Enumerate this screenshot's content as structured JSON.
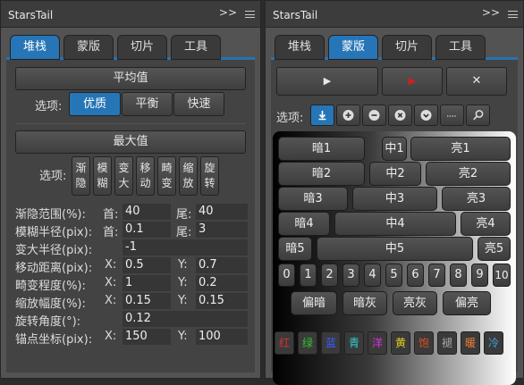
{
  "left": {
    "title": "StarsTail",
    "chevron": ">>",
    "tabs": [
      "堆栈",
      "蒙版",
      "切片",
      "工具"
    ],
    "avg_button": "平均值",
    "options_label": "选项:",
    "opt_buttons": [
      "优质",
      "平衡",
      "快速"
    ],
    "max_button": "最大值",
    "options2_label": "选项:",
    "effects": [
      [
        "渐",
        "隐"
      ],
      [
        "模",
        "糊"
      ],
      [
        "变",
        "大"
      ],
      [
        "移",
        "动"
      ],
      [
        "畸",
        "变"
      ],
      [
        "缩",
        "放"
      ],
      [
        "旋",
        "转"
      ]
    ],
    "rows": [
      {
        "label": "渐隐范围(%):",
        "k1": "首:",
        "v1": "40",
        "k2": "尾:",
        "v2": "40"
      },
      {
        "label": "模糊半径(pix):",
        "k1": "首:",
        "v1": "0.1",
        "k2": "尾:",
        "v2": "3"
      },
      {
        "label": "变大半径(pix):",
        "k1": "",
        "v1": "-1",
        "k2": "",
        "v2": ""
      },
      {
        "label": "移动距离(pix):",
        "k1": "X:",
        "v1": "0.5",
        "k2": "Y:",
        "v2": "0.7"
      },
      {
        "label": "畸变程度(%):",
        "k1": "X:",
        "v1": "1",
        "k2": "Y:",
        "v2": "0.2"
      },
      {
        "label": "缩放幅度(%):",
        "k1": "X:",
        "v1": "0.15",
        "k2": "Y:",
        "v2": "0.15"
      },
      {
        "label": "旋转角度(°):",
        "k1": "",
        "v1": "0.12",
        "k2": "",
        "v2": ""
      },
      {
        "label": "锚点坐标(pix):",
        "k1": "X:",
        "v1": "150",
        "k2": "Y:",
        "v2": "100"
      }
    ]
  },
  "right": {
    "title": "StarsTail",
    "chevron": ">>",
    "tabs": [
      "堆栈",
      "蒙版",
      "切片",
      "工具"
    ],
    "options_label": "选项:",
    "play_icon": "▶",
    "record_icon": "▶",
    "close_icon": "✕",
    "record_color": "#d02020",
    "tone": {
      "r1": [
        "暗1",
        "中1",
        "亮1"
      ],
      "r2": [
        "暗2",
        "中2",
        "亮2"
      ],
      "r3": [
        "暗3",
        "中3",
        "亮3"
      ],
      "r4": [
        "暗4",
        "中4",
        "亮4"
      ],
      "r5": [
        "暗5",
        "中5",
        "亮5"
      ]
    },
    "numbers": [
      "0",
      "1",
      "2",
      "3",
      "4",
      "5",
      "6",
      "7",
      "8",
      "9",
      "10"
    ],
    "grays": [
      "偏暗",
      "暗灰",
      "亮灰",
      "偏亮"
    ],
    "colors": [
      {
        "t": "红",
        "c": "#e03030"
      },
      {
        "t": "绿",
        "c": "#30c030"
      },
      {
        "t": "蓝",
        "c": "#3a5cff"
      },
      {
        "t": "青",
        "c": "#30d0d0"
      },
      {
        "t": "洋",
        "c": "#e030e0"
      },
      {
        "t": "黄",
        "c": "#e0d020"
      },
      {
        "t": "饱",
        "c": "#e05020"
      },
      {
        "t": "褪",
        "c": "#aaaaaa"
      },
      {
        "t": "暖",
        "c": "#f08030"
      },
      {
        "t": "冷",
        "c": "#40a0e0"
      }
    ]
  }
}
